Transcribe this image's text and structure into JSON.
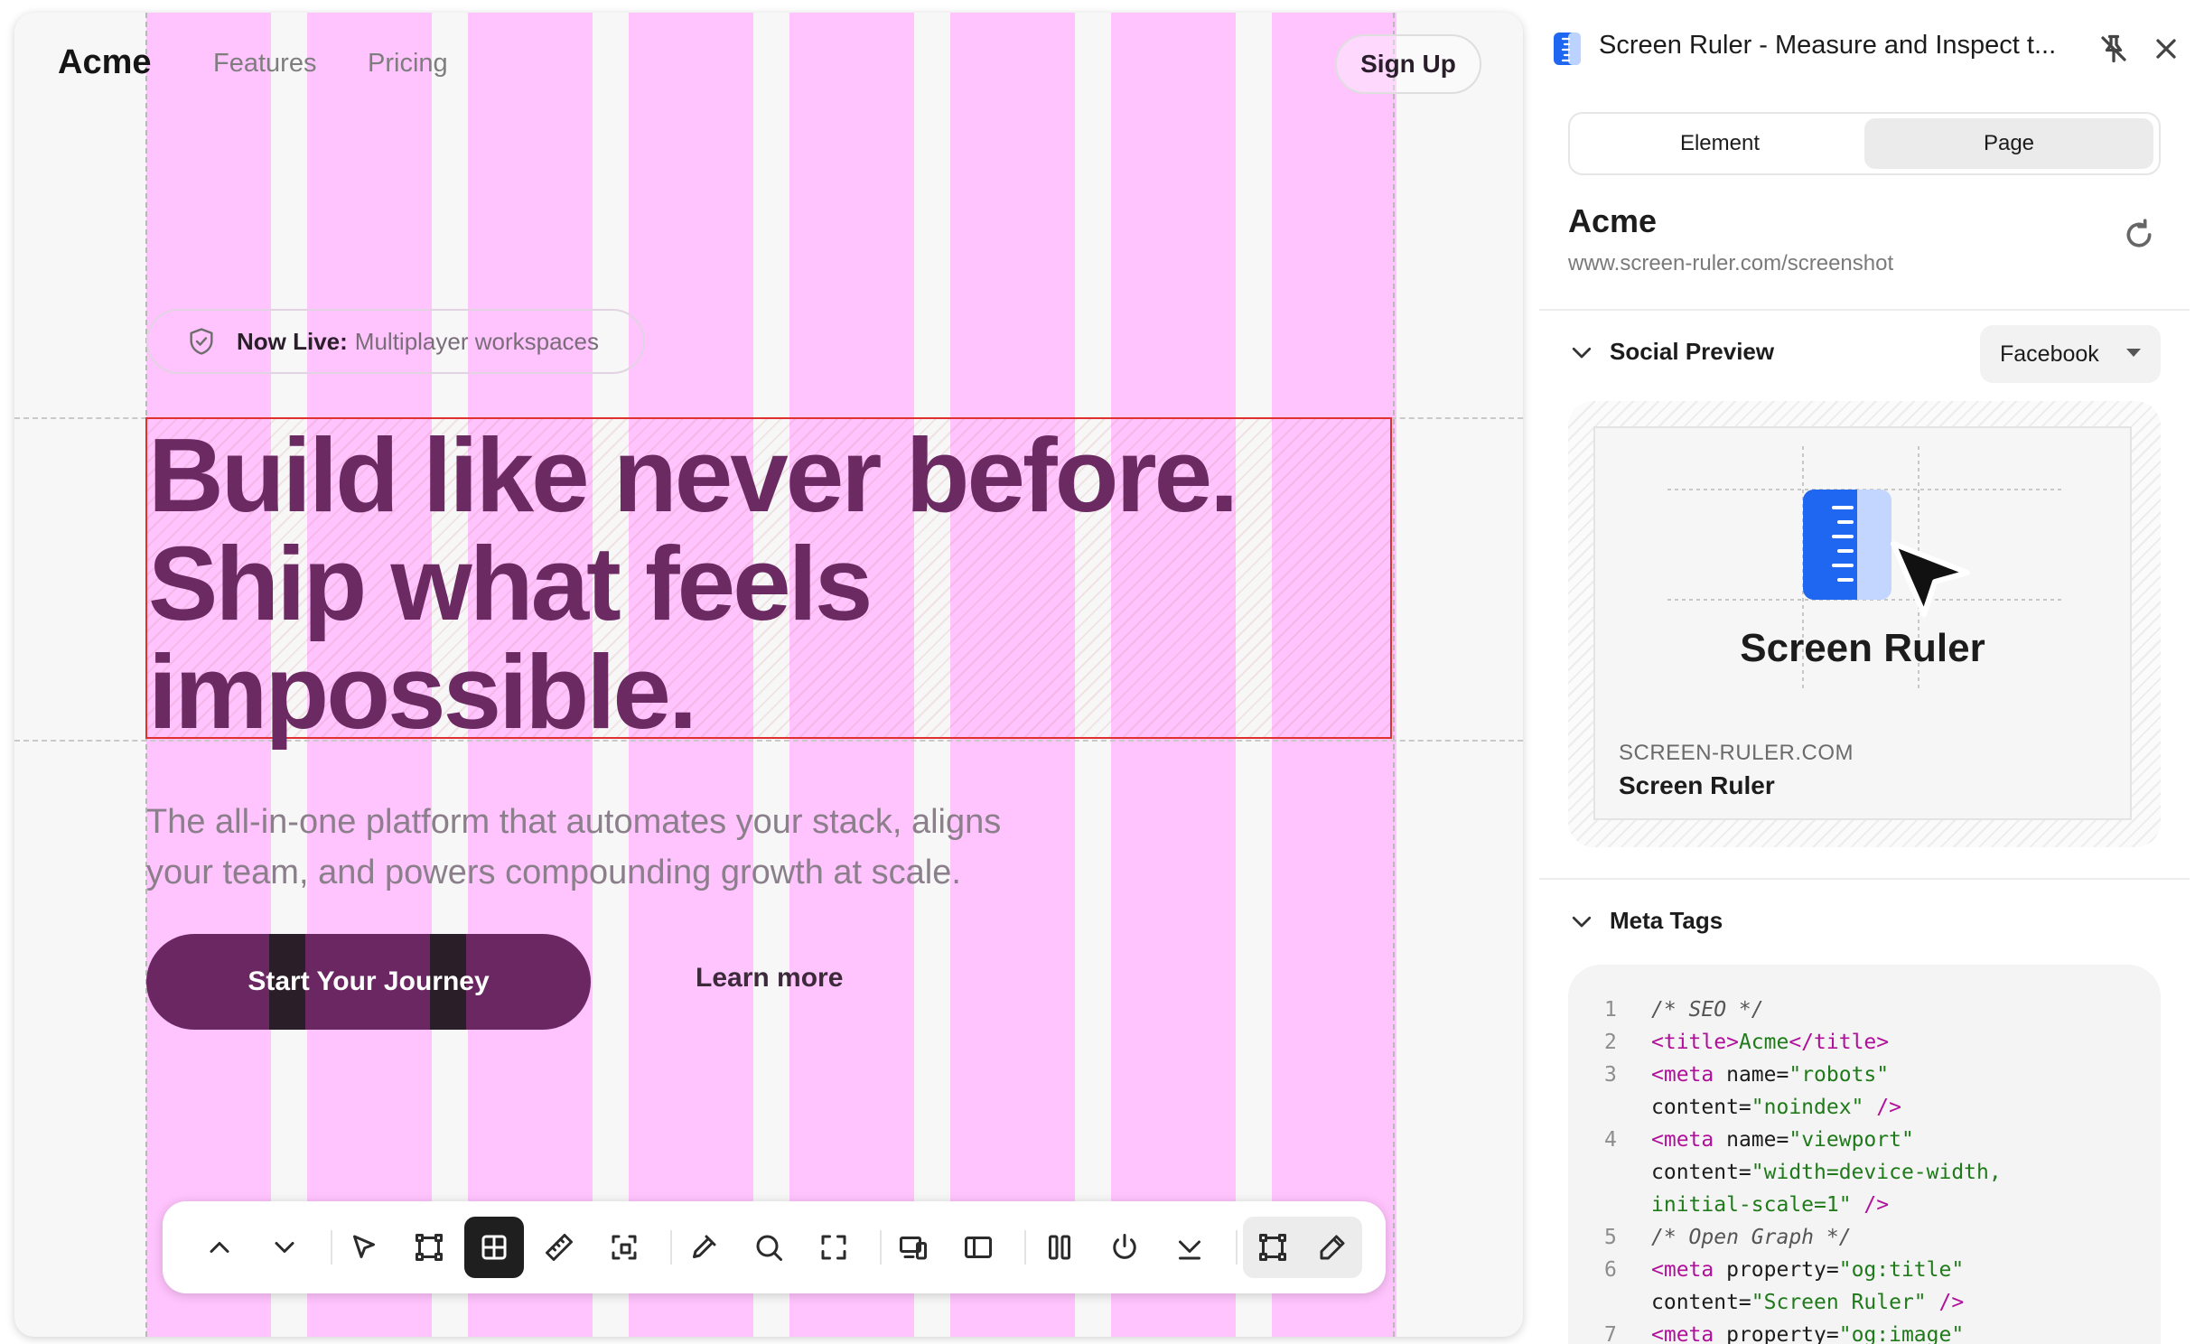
{
  "site": {
    "logo": "Acme",
    "nav": [
      "Features",
      "Pricing"
    ],
    "signup": "Sign Up",
    "badge_strong": "Now Live:",
    "badge_text": "Multiplayer workspaces",
    "hero_lines": [
      "Build like never before.",
      "Ship what feels",
      "impossible."
    ],
    "subtitle_lines": [
      "The all-in-one platform that automates your stack, aligns",
      "your team, and powers compounding growth at scale."
    ],
    "cta": "Start Your Journey",
    "learn_more": "Learn more",
    "grid_color": "#ffc3fd",
    "accent": "#6a2762"
  },
  "toolbar": {
    "tools": [
      {
        "name": "chevron-up-icon"
      },
      {
        "name": "chevron-down-icon"
      },
      {
        "name": "select-cursor-icon"
      },
      {
        "name": "bounding-box-icon"
      },
      {
        "name": "grid-overlay-icon",
        "active": true
      },
      {
        "name": "ruler-icon"
      },
      {
        "name": "dashed-selection-icon"
      },
      {
        "name": "color-picker-icon"
      },
      {
        "name": "zoom-icon"
      },
      {
        "name": "fullscreen-frame-icon"
      },
      {
        "name": "responsive-devices-icon"
      },
      {
        "name": "sidebar-panel-icon"
      },
      {
        "name": "columns-icon"
      },
      {
        "name": "power-icon"
      },
      {
        "name": "download-icon"
      },
      {
        "name": "box-select-icon",
        "soft": true
      },
      {
        "name": "pencil-icon",
        "soft": true
      }
    ]
  },
  "panel": {
    "title": "Screen Ruler - Measure and Inspect t...",
    "tabs": [
      "Element",
      "Page"
    ],
    "selected_tab": "Page",
    "site_name": "Acme",
    "site_url": "www.screen-ruler.com/screenshot",
    "social_preview": {
      "heading": "Social Preview",
      "platform": "Facebook",
      "og_brand": "Screen Ruler",
      "domain": "SCREEN-RULER.COM",
      "title": "Screen Ruler"
    },
    "meta_tags": {
      "heading": "Meta Tags",
      "lines": [
        {
          "n": "1",
          "parts": [
            [
              "cm",
              "/* SEO */"
            ]
          ]
        },
        {
          "n": "2",
          "parts": [
            [
              "tg",
              "<title>"
            ],
            [
              "tx",
              "Acme"
            ],
            [
              "tg",
              "</title>"
            ]
          ]
        },
        {
          "n": "3",
          "parts": [
            [
              "tg",
              "<meta "
            ],
            [
              "at",
              "name="
            ],
            [
              "sv",
              "\"robots\""
            ]
          ]
        },
        {
          "n": "",
          "parts": [
            [
              "at",
              "content="
            ],
            [
              "sv",
              "\"noindex\""
            ],
            [
              "tg",
              " />"
            ]
          ]
        },
        {
          "n": "4",
          "parts": [
            [
              "tg",
              "<meta "
            ],
            [
              "at",
              "name="
            ],
            [
              "sv",
              "\"viewport\""
            ]
          ]
        },
        {
          "n": "",
          "parts": [
            [
              "at",
              "content="
            ],
            [
              "sv",
              "\"width=device-width,"
            ]
          ]
        },
        {
          "n": "",
          "parts": [
            [
              "sv",
              "initial-scale=1\""
            ],
            [
              "tg",
              " />"
            ]
          ]
        },
        {
          "n": "5",
          "parts": [
            [
              "cm",
              "/* Open Graph */"
            ]
          ]
        },
        {
          "n": "6",
          "parts": [
            [
              "tg",
              "<meta "
            ],
            [
              "at",
              "property="
            ],
            [
              "sv",
              "\"og:title\""
            ]
          ]
        },
        {
          "n": "",
          "parts": [
            [
              "at",
              "content="
            ],
            [
              "sv",
              "\"Screen Ruler\""
            ],
            [
              "tg",
              " />"
            ]
          ]
        },
        {
          "n": "7",
          "parts": [
            [
              "tg",
              "<meta "
            ],
            [
              "at",
              "property="
            ],
            [
              "sv",
              "\"og:image\""
            ]
          ]
        }
      ]
    }
  }
}
